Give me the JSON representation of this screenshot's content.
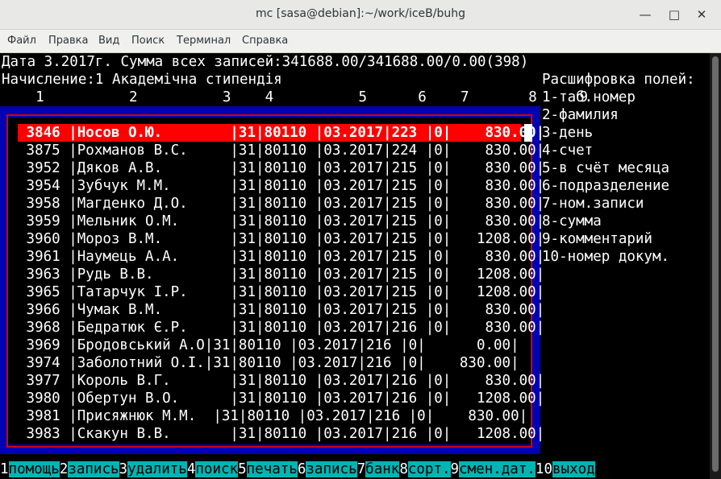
{
  "window": {
    "title": "mc [sasa@debian]:~/work/iceB/buhg"
  },
  "menu": [
    "Файл",
    "Правка",
    "Вид",
    "Поиск",
    "Терминал",
    "Справка"
  ],
  "header": {
    "line1": "Дата 3.2017г. Сумма всех записей:341688.00/341688.00/0.00(398)",
    "line2": "Начисление:1 Академічна стипендія",
    "col_numbers": "    1          2          3    4          5      6    7       8     9"
  },
  "rows": [
    " 3846 |Носов О.Ю.        |31|80110 |03.2017|223 |0|    830.00|",
    " 3875 |Рохманов В.С.     |31|80110 |03.2017|224 |0|    830.00|",
    " 3952 |Дяков А.В.        |31|80110 |03.2017|215 |0|    830.00|",
    " 3954 |Зубчук М.М.       |31|80110 |03.2017|215 |0|    830.00|",
    " 3958 |Магденко Д.О.     |31|80110 |03.2017|215 |0|    830.00|",
    " 3959 |Мельник О.М.      |31|80110 |03.2017|215 |0|    830.00|",
    " 3960 |Мороз В.М.        |31|80110 |03.2017|215 |0|   1208.00|",
    " 3961 |Наумець А.А.      |31|80110 |03.2017|215 |0|    830.00|",
    " 3963 |Рудь В.В.         |31|80110 |03.2017|215 |0|   1208.00|",
    " 3965 |Татарчук І.Р.     |31|80110 |03.2017|215 |0|   1208.00|",
    " 3966 |Чумак В.М.        |31|80110 |03.2017|215 |0|    830.00|",
    " 3968 |Бедратюк Є.Р.     |31|80110 |03.2017|216 |0|    830.00|",
    " 3969 |Бродовський А.О|31|80110 |03.2017|216 |0|      0.00|",
    " 3974 |Заболотний О.І.|31|80110 |03.2017|216 |0|    830.00|",
    " 3977 |Король В.Г.       |31|80110 |03.2017|216 |0|    830.00|",
    " 3980 |Обертун В.О.      |31|80110 |03.2017|216 |0|   1208.00|",
    " 3981 |Присяжнюк М.М.  |31|80110 |03.2017|216 |0|    830.00|",
    " 3983 |Скакун В.В.       |31|80110 |03.2017|216 |0|   1208.00|"
  ],
  "legend": [
    "Расшифровка полей:",
    "1-таб.номер",
    "2-фамилия",
    "3-день",
    "4-счет",
    "5-в счёт месяца",
    "6-подразделение",
    "7-ном.записи",
    "8-сумма",
    "9-комментарий",
    "10-номер докум."
  ],
  "fkeys": [
    {
      "num": "1",
      "label": "помощь"
    },
    {
      "num": "2",
      "label": "запись"
    },
    {
      "num": "3",
      "label": "удалить"
    },
    {
      "num": "4",
      "label": "поиск"
    },
    {
      "num": "5",
      "label": "печать"
    },
    {
      "num": "6",
      "label": "запись"
    },
    {
      "num": "7",
      "label": "банк"
    },
    {
      "num": "8",
      "label": "сорт."
    },
    {
      "num": "9",
      "label": "смен.дат."
    },
    {
      "num": "10",
      "label": "выход"
    }
  ],
  "colors": {
    "selected_row": "#ff0000",
    "frame_blue": "#0000b4",
    "fkey_label_bg": "#00b4b4"
  }
}
